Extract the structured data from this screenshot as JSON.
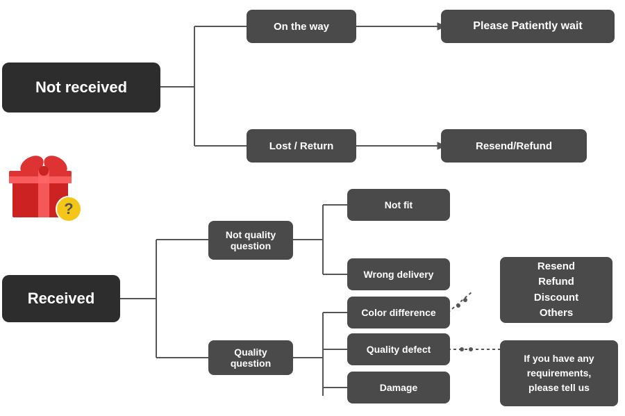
{
  "nodes": {
    "not_received": "Not received",
    "on_the_way": "On the way",
    "please_wait": "Please Patiently wait",
    "lost_return": "Lost / Return",
    "resend_refund_top": "Resend/Refund",
    "received": "Received",
    "not_quality": "Not quality\nquestion",
    "quality_question": "Quality question",
    "not_fit": "Not fit",
    "wrong_delivery": "Wrong delivery",
    "color_difference": "Color difference",
    "quality_defect": "Quality defect",
    "damage": "Damage",
    "resend_refund_options": "Resend\nRefund\nDiscount\nOthers",
    "requirements": "If you have any\nrequirements,\nplease tell us"
  }
}
